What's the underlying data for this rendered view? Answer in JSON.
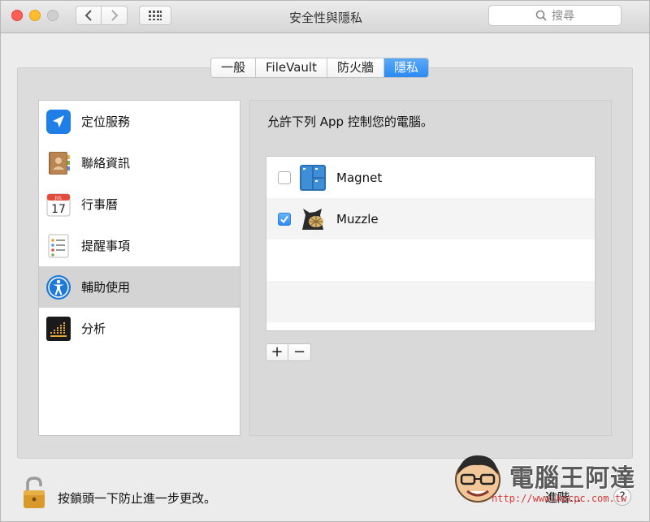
{
  "window": {
    "title": "安全性與隱私",
    "search_placeholder": "搜尋"
  },
  "tabs": [
    {
      "label": "一般",
      "active": false
    },
    {
      "label": "FileVault",
      "active": false
    },
    {
      "label": "防火牆",
      "active": false
    },
    {
      "label": "隱私",
      "active": true
    }
  ],
  "sidebar": {
    "items": [
      {
        "label": "定位服務",
        "icon": "location-arrow-icon"
      },
      {
        "label": "聯絡資訊",
        "icon": "contacts-book-icon"
      },
      {
        "label": "行事曆",
        "icon": "calendar-icon"
      },
      {
        "label": "提醒事項",
        "icon": "reminders-icon"
      },
      {
        "label": "輔助使用",
        "icon": "accessibility-icon",
        "selected": true
      },
      {
        "label": "分析",
        "icon": "analytics-icon"
      }
    ]
  },
  "calendar_icon": {
    "month": "JUL",
    "day": "17"
  },
  "main": {
    "prompt": "允許下列 App 控制您的電腦。",
    "apps": [
      {
        "name": "Magnet",
        "checked": false,
        "icon": "magnet-app-icon"
      },
      {
        "name": "Muzzle",
        "checked": true,
        "icon": "muzzle-app-icon"
      }
    ],
    "plus_label": "+",
    "minus_label": "−"
  },
  "footer": {
    "lock_text": "按鎖頭一下防止進一步更改。",
    "advanced_label": "進階...",
    "help_label": "?"
  },
  "watermark": {
    "brand": "電腦王阿達",
    "url": "http://www.kocpc.com.tw"
  },
  "colors": {
    "accent": "#2b8af1",
    "window_bg": "#ececec",
    "panel_bg": "#dcdcdc"
  }
}
